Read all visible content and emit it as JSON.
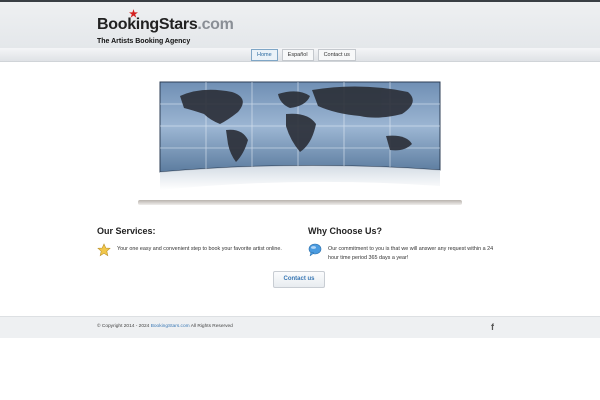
{
  "header": {
    "logo_brand": "BookingStars",
    "logo_suffix": ".com",
    "tagline": "The Artists Booking Agency"
  },
  "nav": {
    "items": [
      {
        "label": "Home",
        "active": true
      },
      {
        "label": "Español",
        "active": false
      },
      {
        "label": "Contact us",
        "active": false
      }
    ]
  },
  "services": {
    "title": "Our Services:",
    "text": "Your one easy and convenient step to book your favorite artist online.",
    "icon": "star-icon"
  },
  "why": {
    "title": "Why Choose Us?",
    "text": "Our commitment to you is that we will answer any request within a 24 hour time period 365 days a year!",
    "icon": "chat-bubble-icon"
  },
  "cta": {
    "label": "Contact us"
  },
  "footer": {
    "copyright_prefix": "© Copyright 2014 - 2024",
    "site_link": "BookingStars.com",
    "copyright_suffix": "All Rights Reserved",
    "social_icon": "facebook-icon"
  },
  "colors": {
    "accent": "#3a78b5",
    "logo_star": "#d42020",
    "topbar": "#3a3f45"
  }
}
